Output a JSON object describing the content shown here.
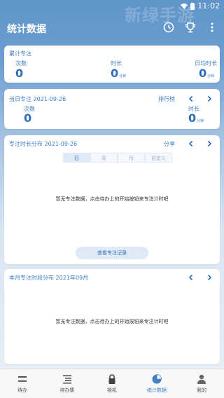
{
  "status": {
    "time": "11:02"
  },
  "watermark": "新绿手游",
  "header": {
    "title": "统计数据"
  },
  "total": {
    "title": "累计专注",
    "count_label": "次数",
    "count_value": "0",
    "duration_label": "时长",
    "duration_value": "0",
    "duration_unit": "分钟",
    "avg_label": "日均时长",
    "avg_value": "0",
    "avg_unit": "分钟"
  },
  "today": {
    "title": "当日专注 2021-09-26",
    "rank_label": "排行榜",
    "count_label": "次数",
    "count_value": "0",
    "duration_label": "时长",
    "duration_value": "0",
    "duration_unit": "分钟"
  },
  "distribution": {
    "title": "专注时长分布 2021-09-26",
    "share_label": "分享",
    "segments": [
      "日",
      "周",
      "月",
      "自定义"
    ],
    "empty_text": "暂无专注数据，点击待办上的开始按钮来专注计时吧",
    "records_button": "查看专注记录"
  },
  "monthly": {
    "title": "本月专注时段分布 2021年09月",
    "empty_text": "暂无专注数据，点击待办上的开始按钮来专注计时吧"
  },
  "tabs": [
    {
      "label": "待办",
      "icon": "todo-icon"
    },
    {
      "label": "待办集",
      "icon": "todo-set-icon"
    },
    {
      "label": "锁机",
      "icon": "lock-icon"
    },
    {
      "label": "统计数据",
      "icon": "pie-chart-icon"
    },
    {
      "label": "我的",
      "icon": "person-icon"
    }
  ],
  "colors": {
    "accent": "#3f7fc6",
    "header": "#5f95c9"
  }
}
